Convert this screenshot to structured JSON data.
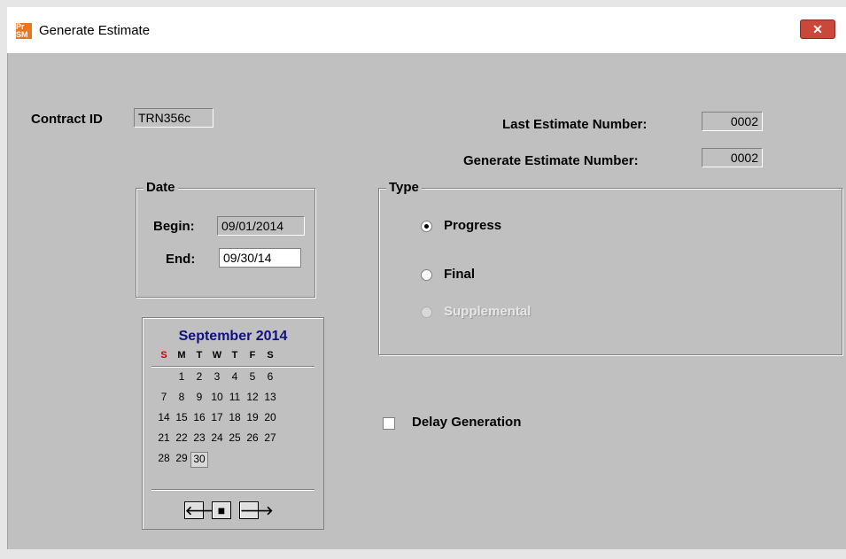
{
  "window": {
    "title": "Generate Estimate",
    "icon_text_top": "Pr",
    "icon_text_bottom": "SM",
    "close_label": "✕"
  },
  "contract": {
    "label": "Contract ID",
    "value": "TRN356c"
  },
  "last_estimate": {
    "label": "Last Estimate Number:",
    "value": "0002"
  },
  "generate_estimate": {
    "label": "Generate Estimate Number:",
    "value": "0002"
  },
  "date_group": {
    "title": "Date",
    "begin_label": "Begin:",
    "begin_value": "09/01/2014",
    "end_label": "End:",
    "end_value": "09/30/14"
  },
  "type_group": {
    "title": "Type",
    "options": [
      {
        "label": "Progress",
        "selected": true,
        "enabled": true
      },
      {
        "label": "Final",
        "selected": false,
        "enabled": true
      },
      {
        "label": "Supplemental",
        "selected": false,
        "enabled": false
      }
    ]
  },
  "delay": {
    "label": "Delay Generation",
    "checked": false
  },
  "calendar": {
    "month_title": "September 2014",
    "weekdays": [
      "S",
      "M",
      "T",
      "W",
      "T",
      "F",
      "S"
    ],
    "weeks": [
      [
        "",
        "1",
        "2",
        "3",
        "4",
        "5",
        "6"
      ],
      [
        "7",
        "8",
        "9",
        "10",
        "11",
        "12",
        "13"
      ],
      [
        "14",
        "15",
        "16",
        "17",
        "18",
        "19",
        "20"
      ],
      [
        "21",
        "22",
        "23",
        "24",
        "25",
        "26",
        "27"
      ],
      [
        "28",
        "29",
        "30",
        "",
        "",
        "",
        ""
      ]
    ],
    "selected_day": "30",
    "nav": {
      "prev": "🡐",
      "today": "■",
      "next": "🡒"
    }
  },
  "colors": {
    "client_bg": "#c0c0c0",
    "calendar_title": "#101080",
    "sunday": "#cc0000",
    "close_button": "#c9483a"
  }
}
